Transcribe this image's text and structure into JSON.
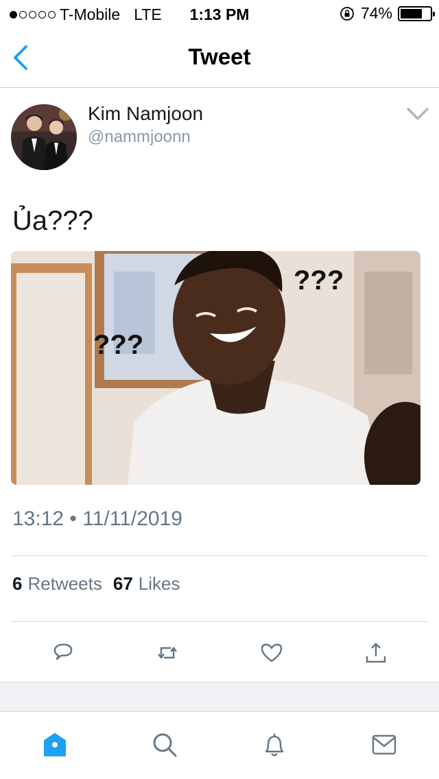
{
  "status_bar": {
    "carrier": "T-Mobile",
    "network": "LTE",
    "time": "1:13 PM",
    "battery": "74%",
    "battery_level": 0.74,
    "signal_bars_filled": 1,
    "signal_bars_total": 5
  },
  "nav": {
    "title": "Tweet",
    "back_icon": "chevron-left-icon"
  },
  "tweet": {
    "author_name": "Kim Namjoon",
    "author_handle": "@nammjoonn",
    "text": "Ủa???",
    "media_caption_left": "???",
    "media_caption_right": "???",
    "timestamp": "13:12 • 11/11/2019",
    "retweets_count": "6",
    "retweets_label": "Retweets",
    "likes_count": "67",
    "likes_label": "Likes"
  },
  "actions": [
    {
      "name": "reply",
      "icon": "reply-icon"
    },
    {
      "name": "retweet",
      "icon": "retweet-icon"
    },
    {
      "name": "like",
      "icon": "heart-icon"
    },
    {
      "name": "share",
      "icon": "share-icon"
    }
  ],
  "tabs": [
    {
      "name": "home",
      "icon": "home-icon",
      "active": true
    },
    {
      "name": "search",
      "icon": "search-icon",
      "active": false
    },
    {
      "name": "notifications",
      "icon": "bell-icon",
      "active": false
    },
    {
      "name": "messages",
      "icon": "mail-icon",
      "active": false
    }
  ],
  "colors": {
    "accent": "#1da1f2",
    "icon_gray": "#657786",
    "text_secondary": "#8899a6"
  }
}
